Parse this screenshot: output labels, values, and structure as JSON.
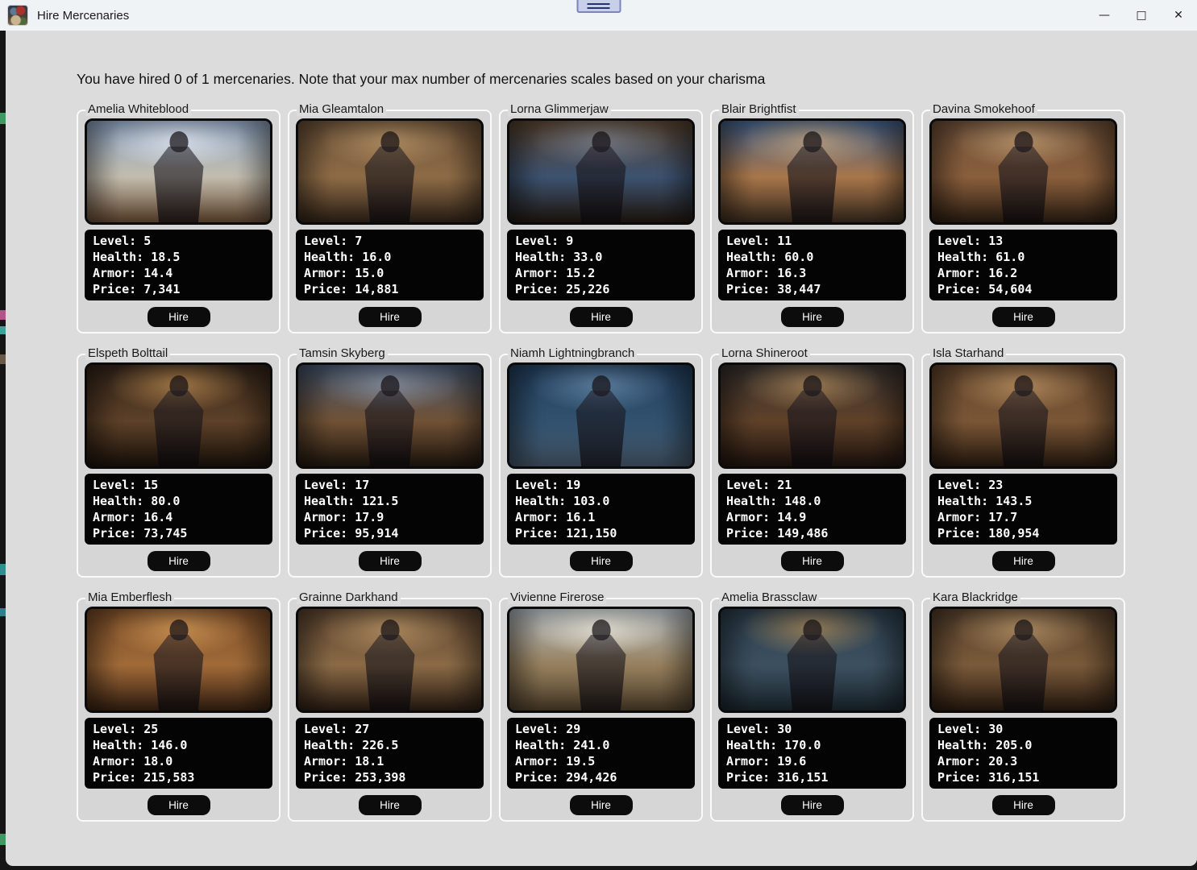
{
  "window": {
    "title": "Hire Mercenaries",
    "icons": {
      "minimize": "—",
      "maximize": "□",
      "close": "✕"
    }
  },
  "header": {
    "message": "You have hired 0 of 1 mercenaries. Note that your max number of mercenaries scales based on your charisma"
  },
  "stats_labels": {
    "level": "Level:",
    "health": "Health:",
    "armor": "Armor:",
    "price": "Price:",
    "hire": "Hire"
  },
  "colors": {
    "titlebar_bg": "#eff3f6",
    "content_bg": "#dcdcdc",
    "card_bg": "#d6d6d6",
    "card_border": "#fafafa",
    "stats_panel_bg": "#040404",
    "stats_text": "#ffffff",
    "hire_button_bg": "#0c0c0c",
    "snap_handle_fill": "#c8cfe9",
    "snap_handle_border": "#7a84bd"
  },
  "mercenaries": [
    {
      "name": "Amelia Whiteblood",
      "level": "5",
      "health": "18.5",
      "armor": "14.4",
      "price": "7,341",
      "art": {
        "top": "#8fa6c4",
        "mid": "#c2bcae",
        "bottom": "#6a4c34",
        "glow": "rgba(235,242,255,0.85)"
      }
    },
    {
      "name": "Mia Gleamtalon",
      "level": "7",
      "health": "16.0",
      "armor": "15.0",
      "price": "14,881",
      "art": {
        "top": "#6b5138",
        "mid": "#8d6b46",
        "bottom": "#33251a",
        "glow": "rgba(240,200,140,0.5)"
      }
    },
    {
      "name": "Lorna Glimmerjaw",
      "level": "9",
      "health": "33.0",
      "armor": "15.2",
      "price": "25,226",
      "art": {
        "top": "#57422e",
        "mid": "#3d5270",
        "bottom": "#241a12",
        "glow": "rgba(180,200,230,0.4)"
      }
    },
    {
      "name": "Blair Brightfist",
      "level": "11",
      "health": "60.0",
      "armor": "16.3",
      "price": "38,447",
      "art": {
        "top": "#42608a",
        "mid": "#a8764a",
        "bottom": "#3c2d20",
        "glow": "rgba(255,210,150,0.55)"
      }
    },
    {
      "name": "Davina Smokehoof",
      "level": "13",
      "health": "61.0",
      "armor": "16.2",
      "price": "54,604",
      "art": {
        "top": "#6e503a",
        "mid": "#8a5f3c",
        "bottom": "#2e2014",
        "glow": "rgba(255,215,160,0.5)"
      }
    },
    {
      "name": "Elspeth Bolttail",
      "level": "15",
      "health": "80.0",
      "armor": "16.4",
      "price": "73,745",
      "art": {
        "top": "#33241a",
        "mid": "#5d4128",
        "bottom": "#1c130c",
        "glow": "rgba(255,190,110,0.55)"
      }
    },
    {
      "name": "Tamsin Skyberg",
      "level": "17",
      "health": "121.5",
      "armor": "17.9",
      "price": "95,914",
      "art": {
        "top": "#43536b",
        "mid": "#705236",
        "bottom": "#221810",
        "glow": "rgba(200,215,240,0.45)"
      }
    },
    {
      "name": "Niamh Lightningbranch",
      "level": "19",
      "health": "103.0",
      "armor": "16.1",
      "price": "121,150",
      "art": {
        "top": "#24405e",
        "mid": "#31516e",
        "bottom": "#46586a",
        "glow": "rgba(150,190,230,0.5)"
      }
    },
    {
      "name": "Lorna Shineroot",
      "level": "21",
      "health": "148.0",
      "armor": "14.9",
      "price": "149,486",
      "art": {
        "top": "#35302e",
        "mid": "#5f4129",
        "bottom": "#211510",
        "glow": "rgba(255,200,130,0.5)"
      }
    },
    {
      "name": "Isla Starhand",
      "level": "23",
      "health": "143.5",
      "armor": "17.7",
      "price": "180,954",
      "art": {
        "top": "#64462e",
        "mid": "#7a5636",
        "bottom": "#2a1c11",
        "glow": "rgba(255,205,140,0.5)"
      }
    },
    {
      "name": "Mia Emberflesh",
      "level": "25",
      "health": "146.0",
      "armor": "18.0",
      "price": "215,583",
      "art": {
        "top": "#7a4c28",
        "mid": "#a06a38",
        "bottom": "#3a2314",
        "glow": "rgba(255,190,110,0.6)"
      }
    },
    {
      "name": "Grainne Darkhand",
      "level": "27",
      "health": "226.5",
      "armor": "18.1",
      "price": "253,398",
      "art": {
        "top": "#5c4430",
        "mid": "#8a6a46",
        "bottom": "#2e2016",
        "glow": "rgba(250,205,140,0.5)"
      }
    },
    {
      "name": "Vivienne Firerose",
      "level": "29",
      "health": "241.0",
      "armor": "19.5",
      "price": "294,426",
      "art": {
        "top": "#b6bec4",
        "mid": "#96805e",
        "bottom": "#50402c",
        "glow": "rgba(255,250,235,0.75)"
      }
    },
    {
      "name": "Amelia Brassclaw",
      "level": "30",
      "health": "170.0",
      "armor": "19.6",
      "price": "316,151",
      "art": {
        "top": "#2c3e4c",
        "mid": "#3c5060",
        "bottom": "#1c2830",
        "glow": "rgba(240,180,100,0.55)"
      }
    },
    {
      "name": "Kara Blackridge",
      "level": "30",
      "health": "205.0",
      "armor": "20.3",
      "price": "316,151",
      "art": {
        "top": "#55402c",
        "mid": "#7a5a3a",
        "bottom": "#2c1d12",
        "glow": "rgba(255,210,150,0.5)"
      }
    }
  ]
}
